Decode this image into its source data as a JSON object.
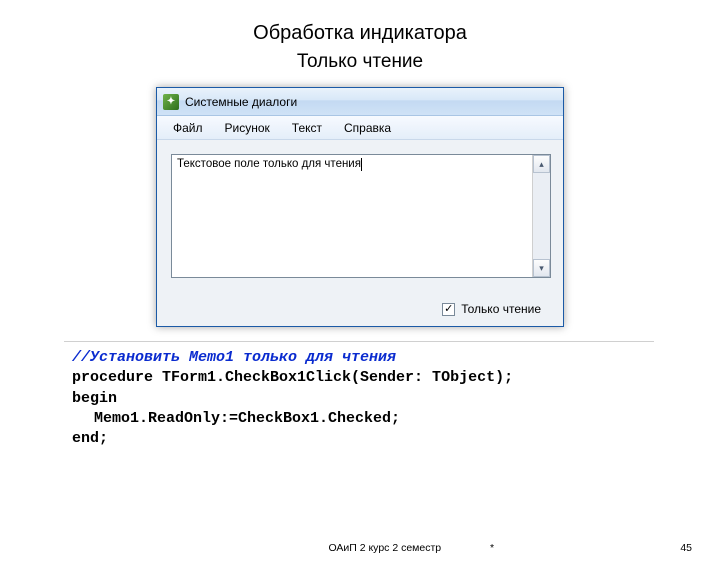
{
  "slide": {
    "title": "Обработка индикатора",
    "subtitle": "Только чтение"
  },
  "window": {
    "title": "Системные диалоги",
    "menu": [
      "Файл",
      "Рисунок",
      "Текст",
      "Справка"
    ],
    "memo_text": "Текстовое поле только для чтения",
    "checkbox_label": "Только чтение",
    "checkbox_checked": "✓"
  },
  "code": {
    "comment": "//Установить Memo1 только для чтения",
    "line1a": "procedure",
    "line1b": " TForm1.CheckBox1Click(Sender: TObject);",
    "line2": "begin",
    "line3": "Memo1.ReadOnly:=CheckBox1.Checked;",
    "line4": "end;"
  },
  "footer": {
    "center": "ОАиП 2 курс 2 семестр",
    "star": "*",
    "page": "45"
  }
}
